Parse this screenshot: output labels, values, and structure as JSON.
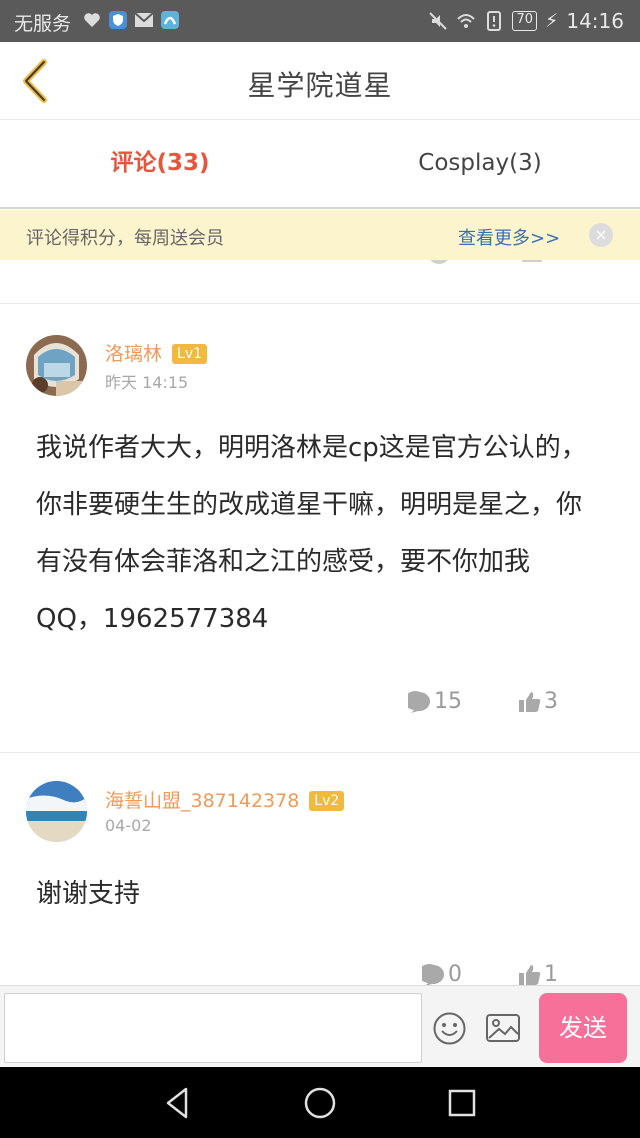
{
  "status_bar": {
    "carrier": "无服务",
    "battery": "70",
    "time": "14:16"
  },
  "header": {
    "title": "星学院道星"
  },
  "tabs": [
    {
      "label": "评论(33)",
      "active": true
    },
    {
      "label": "Cosplay(3)",
      "active": false
    }
  ],
  "notice": {
    "text": "评论得积分，每周送会员",
    "link": "查看更多>>",
    "close": "×"
  },
  "comments": [
    {
      "username": "洛璃林",
      "level": "Lv1",
      "time": "昨天 14:15",
      "content": "我说作者大大，明明洛林是cp这是官方公认的，你非要硬生生的改成道星干嘛，明明是星之，你有没有体会菲洛和之江的感受，要不你加我QQ，1962577384",
      "replies": "15",
      "likes": "3"
    },
    {
      "username": "海誓山盟_387142378",
      "level": "Lv2",
      "time": "04-02",
      "content": "谢谢支持",
      "replies": "0",
      "likes": "1"
    }
  ],
  "input_bar": {
    "placeholder": "",
    "send_label": "发送"
  },
  "colors": {
    "accent": "#e8553d",
    "username": "#f09a57",
    "send": "#f7709a",
    "notice_bg": "#fcf4cd",
    "link": "#3a6fb5"
  }
}
